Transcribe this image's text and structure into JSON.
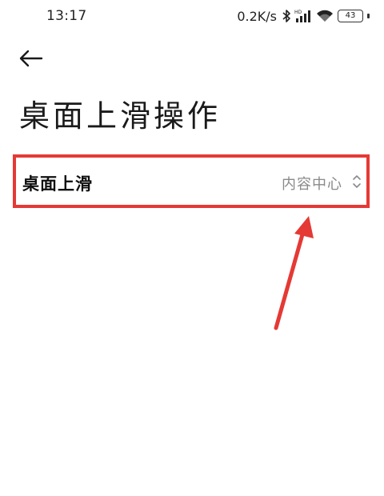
{
  "status_bar": {
    "time": "13:17",
    "net_speed": "0.2K/s",
    "battery_level": "43",
    "icons": [
      "bluetooth-icon",
      "hd-signal-icon",
      "wifi-icon",
      "battery-icon"
    ]
  },
  "nav": {
    "back_icon": "arrow-left-icon"
  },
  "page": {
    "title": "桌面上滑操作"
  },
  "setting": {
    "label": "桌面上滑",
    "value": "内容中心",
    "icon": "chevron-updown-icon"
  },
  "annotation": {
    "color": "#e53935"
  }
}
